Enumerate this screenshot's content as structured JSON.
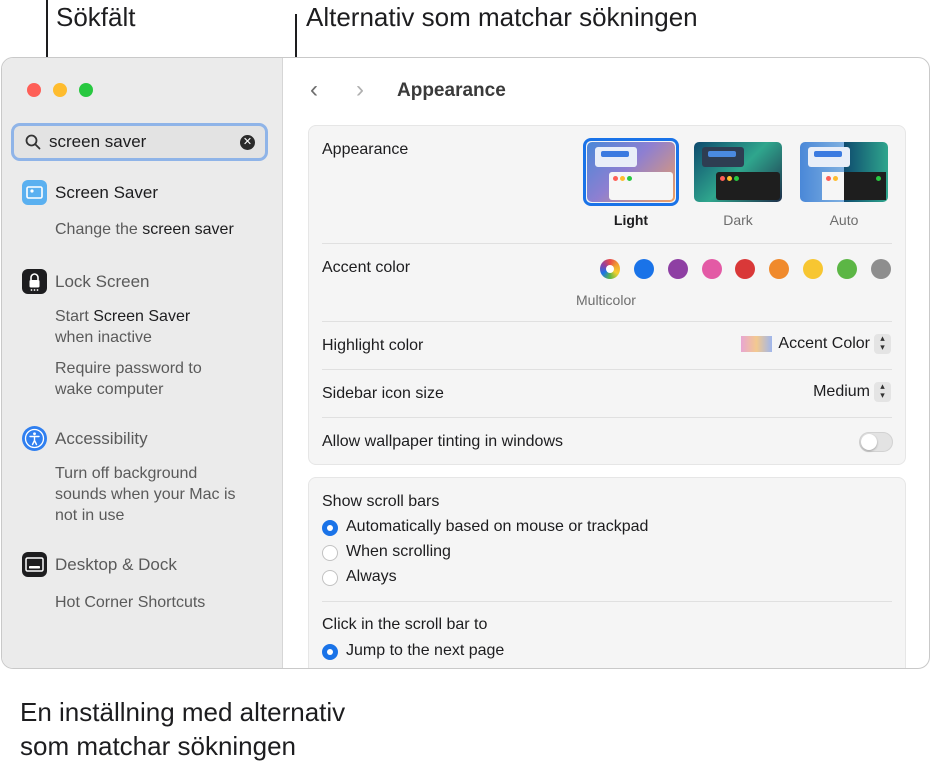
{
  "callouts": {
    "search_field": "Sökfält",
    "matching_options": "Alternativ som matchar sökningen",
    "setting_line1": "En inställning med alternativ",
    "setting_line2": "som matchar sökningen"
  },
  "search": {
    "value": "screen saver"
  },
  "sidebar": {
    "screen_saver": {
      "label": "Screen Saver",
      "sub_prefix": "Change the ",
      "sub_match": "screen saver"
    },
    "lock_screen": {
      "label": "Lock Screen",
      "opt1_prefix": "Start ",
      "opt1_match": "Screen Saver",
      "opt1_line2": "when inactive",
      "opt2_line1": "Require password to",
      "opt2_line2": "wake computer"
    },
    "accessibility": {
      "label": "Accessibility",
      "line1": "Turn off background",
      "line2": "sounds when your Mac is",
      "line3": "not in use"
    },
    "desktop_dock": {
      "label": "Desktop & Dock",
      "sub": "Hot Corner Shortcuts"
    }
  },
  "header": {
    "title": "Appearance"
  },
  "appearance": {
    "label": "Appearance",
    "options": [
      "Light",
      "Dark",
      "Auto"
    ],
    "selected": "Light"
  },
  "accent": {
    "label": "Accent color",
    "caption": "Multicolor",
    "colors": [
      "#f5f5f5",
      "#1a73e8",
      "#8e3fa3",
      "#e35aa5",
      "#d93838",
      "#f08a2c",
      "#f7c631",
      "#5cb645",
      "#8e8e8e"
    ]
  },
  "highlight": {
    "label": "Highlight color",
    "value": "Accent Color"
  },
  "sidebar_icon": {
    "label": "Sidebar icon size",
    "value": "Medium"
  },
  "tinting": {
    "label": "Allow wallpaper tinting in windows",
    "enabled": false
  },
  "scrollbars": {
    "label": "Show scroll bars",
    "options": [
      "Automatically based on mouse or trackpad",
      "When scrolling",
      "Always"
    ],
    "selected": 0
  },
  "click_scroll": {
    "label": "Click in the scroll bar to",
    "option": "Jump to the next page"
  },
  "colors": {
    "accent": "#1a73e8",
    "selection_ring": "#8fb4e8"
  }
}
